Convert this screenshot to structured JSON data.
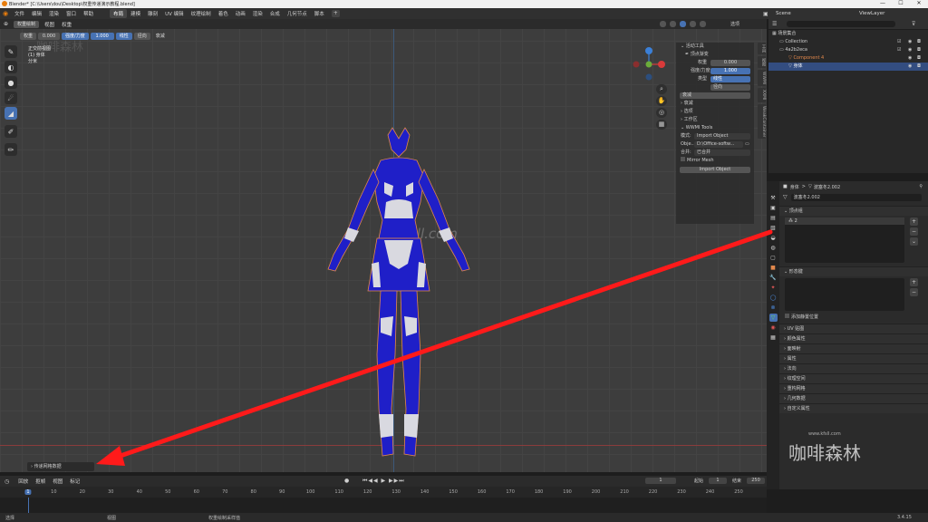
{
  "window": {
    "title": "Blender* [C:\\Users\\dou\\Desktop\\权重传递演示教程.blend]",
    "min": "—",
    "max": "☐",
    "close": "✕"
  },
  "menu": [
    "文件",
    "编辑",
    "渲染",
    "窗口",
    "帮助"
  ],
  "workspaces": [
    "布局",
    "建模",
    "雕刻",
    "UV 编辑",
    "纹理绘制",
    "着色",
    "动画",
    "渲染",
    "合成",
    "几何节点",
    "脚本"
  ],
  "active_workspace": 0,
  "scene": {
    "name": "Scene",
    "view_layer": "ViewLayer"
  },
  "viewport": {
    "mode": "权重绘制",
    "view_menu": "视图",
    "brush_menu": "权重",
    "weight_label": "权重",
    "weight_value": "0.000",
    "strength_label": "强度/力度",
    "strength_value": "1.000",
    "falloff_label": "线性",
    "falloff_opt": "径向",
    "blend": "衰减",
    "info_line1": "正交前视图",
    "info_line2": "(1) 身体",
    "info_line3": "分米",
    "watermark": "kfsll.com",
    "bottom_panel": "传递网格数据",
    "select_label": "选项"
  },
  "npanel": {
    "header": "活动工具",
    "tool_name": "顶点渐变",
    "weight_label": "权重",
    "weight_value": "0.000",
    "strength_label": "强度/力度",
    "strength_value": "1.000",
    "type_label": "类型",
    "type_linear": "线性",
    "type_radial": "径向",
    "falloff_label": "衰减",
    "sections": [
      "衰减",
      "选项",
      "工作区"
    ],
    "wwmi_header": "WWMI Tools",
    "mode_label": "模式:",
    "mode_value": "Import Object",
    "obj_label": "Obje...",
    "obj_value": "D:\\Office-softw...",
    "merge_label": "合并:",
    "merge_value": "已合并",
    "mirror_label": "Mirror Mesh",
    "import_button": "Import Object"
  },
  "side_tabs": [
    "工具",
    "视图",
    "WWMI",
    "XXMI",
    "WeakContainer"
  ],
  "outliner": {
    "search_placeholder": "",
    "rows": [
      {
        "label": "场景集合",
        "indent": 0,
        "icon": "scene-collection-icon"
      },
      {
        "label": "Collection",
        "indent": 1,
        "icon": "collection-icon"
      },
      {
        "label": "4a2b2eca",
        "indent": 1,
        "icon": "collection-icon"
      },
      {
        "label": "Component 4",
        "indent": 2,
        "icon": "mesh-icon",
        "color": "#e2884c"
      },
      {
        "label": "身体",
        "indent": 2,
        "icon": "mesh-icon",
        "selected": true
      }
    ]
  },
  "properties": {
    "breadcrumb_obj": "身体",
    "breadcrumb_sep": ">",
    "breadcrumb_mesh": "波塞冬2.002",
    "mesh_name": "波塞冬2.002",
    "vertex_groups_header": "顶点组",
    "vertex_group_item": "2",
    "shape_keys_header": "形态键",
    "shape_keys_check": "添加静置位置",
    "sections": [
      "UV 贴图",
      "颜色属性",
      "面映射",
      "属性",
      "法向",
      "纹理空间",
      "重构网格",
      "几何数据",
      "自定义属性"
    ],
    "watermark_url": "www.kfsll.com",
    "watermark_brand": "咖啡森林"
  },
  "timeline": {
    "menu": [
      "回放",
      "抠帧",
      "视图",
      "标记"
    ],
    "current_frame": "1",
    "start_label": "起始",
    "start_value": "1",
    "end_label": "结束",
    "end_value": "250",
    "ticks": [
      "1",
      "10",
      "20",
      "30",
      "40",
      "50",
      "60",
      "70",
      "80",
      "90",
      "100",
      "110",
      "120",
      "130",
      "140",
      "150",
      "160",
      "170",
      "180",
      "190",
      "200",
      "210",
      "220",
      "230",
      "240",
      "250"
    ]
  },
  "statusbar": {
    "left": "选择",
    "middle": "视图",
    "right": "权重绘制采样值",
    "version": "3.4.15"
  },
  "colors": {
    "accent": "#4772b3",
    "arrow": "#ff1a1a",
    "model_blue": "#1f1fc8",
    "model_white": "#d9d9e0"
  }
}
